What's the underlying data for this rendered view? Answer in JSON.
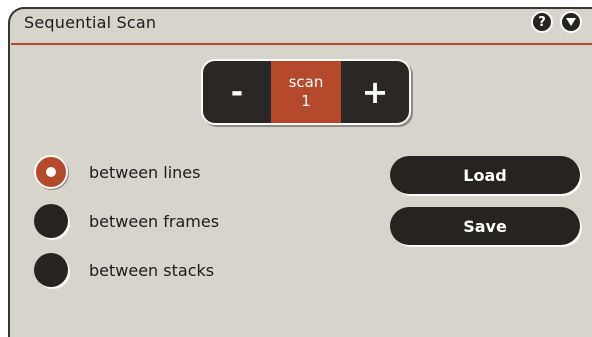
{
  "header": {
    "title": "Sequential Scan",
    "help_glyph": "?",
    "icons": [
      "help-icon",
      "menu-triangle-icon"
    ]
  },
  "stepper": {
    "decrement_label": "-",
    "increment_label": "+",
    "caption": "scan",
    "value": "1"
  },
  "radio_options": [
    {
      "label": "between lines",
      "selected": true
    },
    {
      "label": "between frames",
      "selected": false
    },
    {
      "label": "between stacks",
      "selected": false
    }
  ],
  "buttons": {
    "load_label": "Load",
    "save_label": "Save"
  },
  "colors": {
    "panel_background": "#d6d4cb",
    "accent": "#b5492c",
    "control_dark": "#262320",
    "highlight": "#fbfaf6",
    "text": "#1e1b19"
  }
}
